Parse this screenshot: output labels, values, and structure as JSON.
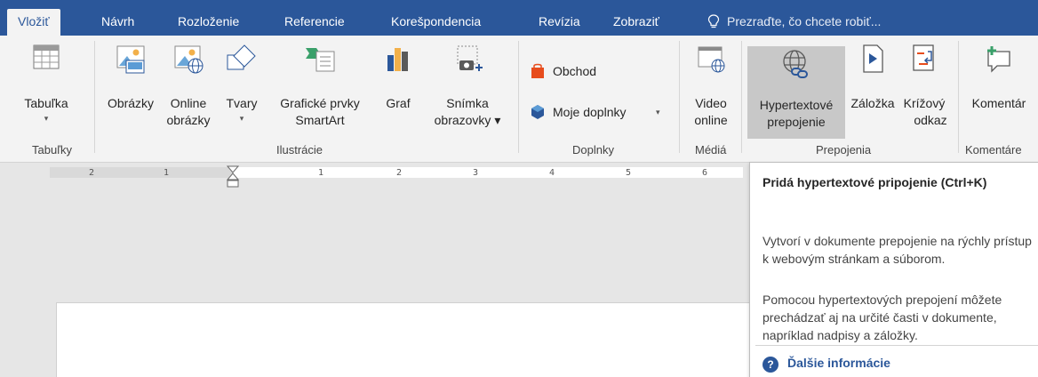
{
  "tabs": [
    "Vložiť",
    "Návrh",
    "Rozloženie",
    "Referencie",
    "Korešpondencia",
    "Revízia",
    "Zobraziť"
  ],
  "tellme": {
    "text": "Prezraďte, čo chcete robiť..."
  },
  "groups": {
    "tables": {
      "label": "Tabuľky",
      "table_btn": "Tabuľka"
    },
    "illustrations": {
      "label": "Ilustrácie",
      "pictures": "Obrázky",
      "online_pictures_1": "Online",
      "online_pictures_2": "obrázky",
      "shapes": "Tvary",
      "smartart_1": "Grafické prvky",
      "smartart_2": "SmartArt",
      "chart": "Graf",
      "screenshot_1": "Snímka",
      "screenshot_2": "obrazovky"
    },
    "addins": {
      "label": "Doplnky",
      "store": "Obchod",
      "my_addins": "Moje doplnky"
    },
    "media": {
      "label": "Médiá",
      "video_1": "Video",
      "video_2": "online"
    },
    "links": {
      "label": "Prepojenia",
      "hyperlink_1": "Hypertextové",
      "hyperlink_2": "prepojenie",
      "bookmark": "Záložka",
      "crossref_1": "Krížový",
      "crossref_2": "odkaz"
    },
    "comments": {
      "label": "Komentáre",
      "comment": "Komentár"
    }
  },
  "ruler": {
    "ticks": [
      "2",
      "1",
      "1",
      "2",
      "3",
      "4",
      "5",
      "6"
    ]
  },
  "tooltip": {
    "title": "Pridá hypertextové pripojenie (Ctrl+K)",
    "p1": "Vytvorí v dokumente prepojenie na rýchly prístup k webovým stránkam a súborom.",
    "p2": "Pomocou hypertextových prepojení môžete prechádzať aj na určité časti v dokumente, napríklad nadpisy a záložky.",
    "more": "Ďalšie informácie"
  },
  "colors": {
    "accent": "#2b579a",
    "ribbon": "#f3f3f3",
    "selected": "#c8c8c8"
  }
}
